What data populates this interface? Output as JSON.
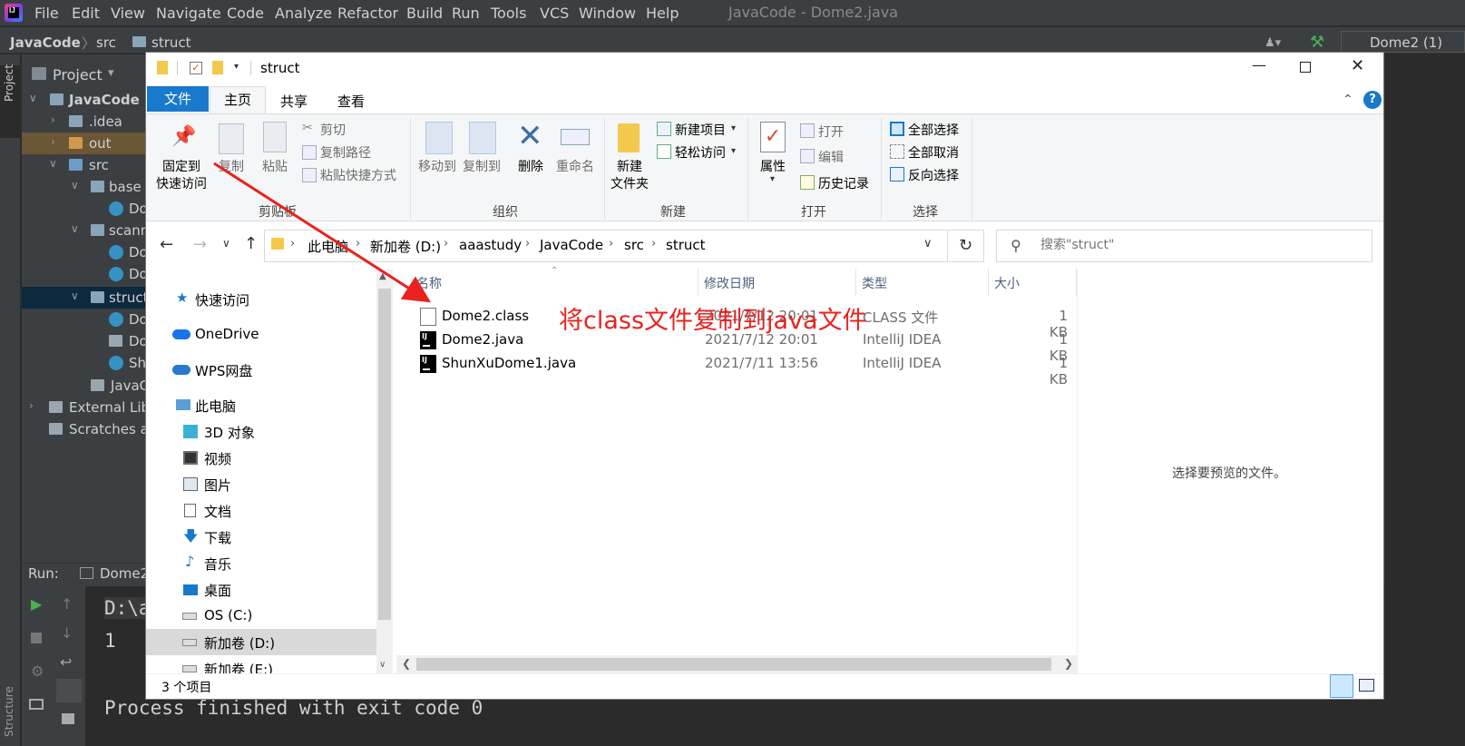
{
  "ide": {
    "menus": [
      "File",
      "Edit",
      "View",
      "Navigate",
      "Code",
      "Analyze",
      "Refactor",
      "Build",
      "Run",
      "Tools",
      "VCS",
      "Window",
      "Help"
    ],
    "window_title": "JavaCode - Dome2.java",
    "breadcrumb": {
      "project": "JavaCode",
      "sep": "〉",
      "src": "src",
      "struct": "struct"
    },
    "run_config": "Dome2 (1)",
    "left_tabs": {
      "project": "Project",
      "structure": "Structure"
    },
    "project_panel": {
      "header": "Project",
      "tree": {
        "javacode": "JavaCode",
        "idea": ".idea",
        "out": "out",
        "src": "src",
        "base": "base",
        "base_child": "Do",
        "scanner": "scann",
        "scanner_child1": "Do",
        "scanner_child2": "Do",
        "struct": "struct",
        "struct_child1": "Do",
        "struct_child2": "Do",
        "struct_child3": "Sh",
        "iml": "JavaCode",
        "external_libs": "External Libr",
        "scratches": "Scratches ar"
      }
    },
    "run_panel": {
      "label": "Run:",
      "tab": "Dome2",
      "console_cmd": "D:\\a",
      "console_output": "1",
      "process_finished": "Process finished with exit code 0"
    }
  },
  "explorer": {
    "title": "struct",
    "tabs": {
      "file": "文件",
      "home": "主页",
      "share": "共享",
      "view": "查看"
    },
    "ribbon": {
      "clipboard": {
        "group": "剪贴板",
        "pin": "固定到\n快速访问",
        "copy": "复制",
        "paste": "粘贴",
        "cut": "剪切",
        "copy_path": "复制路径",
        "paste_shortcut": "粘贴快捷方式"
      },
      "organize": {
        "group": "组织",
        "move_to": "移动到",
        "copy_to": "复制到",
        "delete": "删除",
        "rename": "重命名"
      },
      "new": {
        "group": "新建",
        "new_folder": "新建\n文件夹",
        "new_item": "新建项目",
        "easy_access": "轻松访问"
      },
      "open": {
        "group": "打开",
        "properties": "属性",
        "open": "打开",
        "edit": "编辑",
        "history": "历史记录"
      },
      "select": {
        "group": "选择",
        "select_all": "全部选择",
        "select_none": "全部取消",
        "invert": "反向选择"
      }
    },
    "address": {
      "crumbs": [
        "此电脑",
        "新加卷 (D:)",
        "aaastudy",
        "JavaCode",
        "src",
        "struct"
      ],
      "sep": "›"
    },
    "search": {
      "placeholder": "搜索\"struct\""
    },
    "nav_pane": {
      "quick_access": "快速访问",
      "onedrive": "OneDrive",
      "wps": "WPS网盘",
      "this_pc": "此电脑",
      "objects_3d": "3D 对象",
      "videos": "视频",
      "pictures": "图片",
      "documents": "文档",
      "downloads": "下载",
      "music": "音乐",
      "desktop": "桌面",
      "drive_c": "OS (C:)",
      "drive_d": "新加卷 (D:)",
      "drive_e": "新加卷 (E:)"
    },
    "columns": {
      "name": "名称",
      "date": "修改日期",
      "type": "类型",
      "size": "大小"
    },
    "files": [
      {
        "name": "Dome2.class",
        "date": "2021/7/12 20:01",
        "type": "CLASS 文件",
        "size": "1 KB"
      },
      {
        "name": "Dome2.java",
        "date": "2021/7/12 20:01",
        "type": "IntelliJ IDEA",
        "size": "1 KB"
      },
      {
        "name": "ShunXuDome1.java",
        "date": "2021/7/11 13:56",
        "type": "IntelliJ IDEA",
        "size": "1 KB"
      }
    ],
    "preview_text": "选择要预览的文件。",
    "status": "3 个项目"
  },
  "annotation": {
    "text": "将class文件复制到java文件",
    "color": "#e8231f"
  }
}
